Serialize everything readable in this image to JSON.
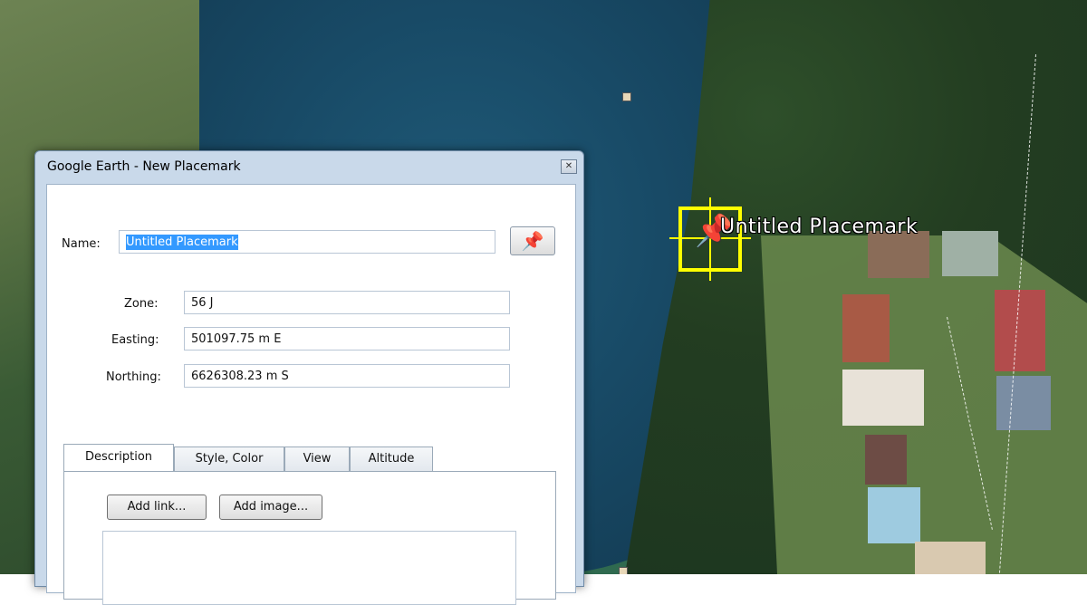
{
  "map": {
    "placemark_label": "Untitled Placemark",
    "pin_icon": "yellow-pushpin-icon",
    "highlight_color": "#ffff00"
  },
  "dialog": {
    "title": "Google Earth - New Placemark",
    "close_icon": "close-icon",
    "name_label": "Name:",
    "name_value": "Untitled Placemark",
    "pin_button_icon": "yellow-pushpin-icon",
    "zone_label": "Zone:",
    "zone_value": "56 J",
    "easting_label": "Easting:",
    "easting_value": "501097.75 m E",
    "northing_label": "Northing:",
    "northing_value": "6626308.23 m S",
    "tabs": [
      {
        "label": "Description",
        "active": true
      },
      {
        "label": "Style, Color",
        "active": false
      },
      {
        "label": "View",
        "active": false
      },
      {
        "label": "Altitude",
        "active": false
      }
    ],
    "add_link_label": "Add link...",
    "add_image_label": "Add image...",
    "description_value": ""
  }
}
